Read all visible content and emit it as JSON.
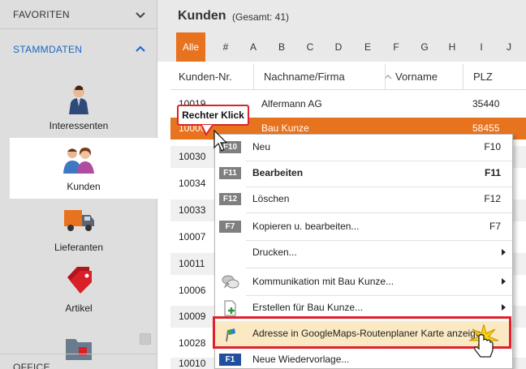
{
  "sidebar": {
    "favorites": "FAVORITEN",
    "stammdaten": "STAMMDATEN",
    "office": "OFFICE",
    "items": [
      {
        "label": "Interessenten",
        "icon": "person-suit-icon"
      },
      {
        "label": "Kunden",
        "icon": "customers-icon"
      },
      {
        "label": "Lieferanten",
        "icon": "truck-icon"
      },
      {
        "label": "Artikel",
        "icon": "tag-icon"
      }
    ]
  },
  "main": {
    "title": "Kunden",
    "count": "(Gesamt: 41)",
    "alpha": [
      "Alle",
      "#",
      "A",
      "B",
      "C",
      "D",
      "E",
      "F",
      "G",
      "H",
      "I",
      "J"
    ],
    "columns": [
      "Kunden-Nr.",
      "Nachname/Firma",
      "Vorname",
      "PLZ"
    ],
    "rows": [
      {
        "nr": "10019",
        "name": "Alfermann AG",
        "plz": "35440"
      },
      {
        "nr": "10000",
        "name": "Bau Kunze",
        "plz": "58455"
      },
      {
        "nr": "10030",
        "name": "",
        "plz": ""
      },
      {
        "nr": "10034",
        "name": "",
        "plz": ""
      },
      {
        "nr": "10033",
        "name": "",
        "plz": ""
      },
      {
        "nr": "10007",
        "name": "",
        "plz": ""
      },
      {
        "nr": "10011",
        "name": "",
        "plz": ""
      },
      {
        "nr": "10006",
        "name": "",
        "plz": ""
      },
      {
        "nr": "10009",
        "name": "",
        "plz": ""
      },
      {
        "nr": "10028",
        "name": "",
        "plz": ""
      },
      {
        "nr": "10010",
        "name": "",
        "plz": ""
      }
    ]
  },
  "context_menu": {
    "items": [
      {
        "key": "F10",
        "label": "Neu",
        "shortcut": "F10"
      },
      {
        "key": "F11",
        "label": "Bearbeiten",
        "shortcut": "F11"
      },
      {
        "key": "F12",
        "label": "Löschen",
        "shortcut": "F12"
      },
      {
        "key": "F7",
        "label": "Kopieren u. bearbeiten...",
        "shortcut": "F7"
      },
      {
        "label": "Drucken..."
      },
      {
        "label": "Kommunikation mit Bau Kunze..."
      },
      {
        "label": "Erstellen für Bau Kunze..."
      },
      {
        "label": "Adresse in GoogleMaps-Routenplaner Karte anzeigen"
      },
      {
        "key": "F1",
        "label": "Neue Wiedervorlage..."
      }
    ]
  },
  "tooltip": "Rechter Klick",
  "colors": {
    "accent": "#e8731f",
    "highlight": "#e0202a",
    "link": "#1a66c4"
  }
}
